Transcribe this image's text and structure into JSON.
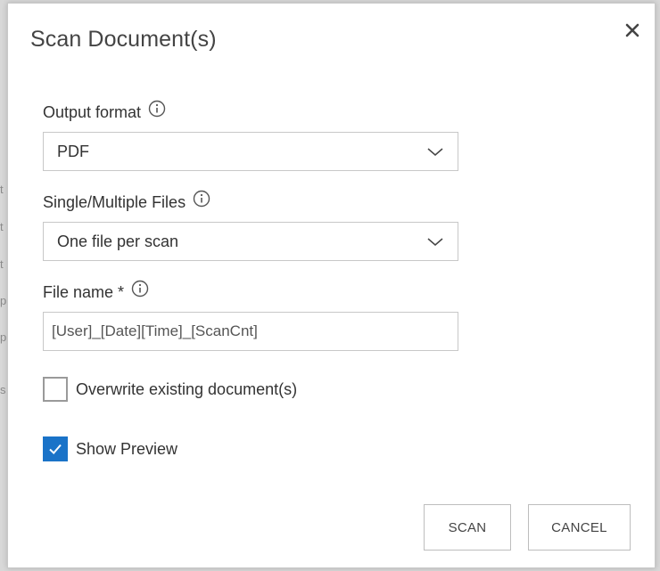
{
  "dialog": {
    "title": "Scan Document(s)",
    "close_icon": "close-icon"
  },
  "fields": {
    "output_format": {
      "label": "Output format",
      "value": "PDF",
      "icon": "info-icon"
    },
    "single_multiple": {
      "label": "Single/Multiple Files",
      "value": "One file per scan",
      "icon": "info-icon"
    },
    "file_name": {
      "label": "File name *",
      "value": "[User]_[Date][Time]_[ScanCnt]",
      "icon": "info-icon"
    }
  },
  "options": {
    "overwrite": {
      "label": "Overwrite existing document(s)",
      "checked": false
    },
    "show_preview": {
      "label": "Show Preview",
      "checked": true
    }
  },
  "buttons": {
    "scan": "SCAN",
    "cancel": "CANCEL"
  },
  "colors": {
    "accent": "#1a73c8",
    "border": "#c8c8c8",
    "text": "#333333"
  }
}
